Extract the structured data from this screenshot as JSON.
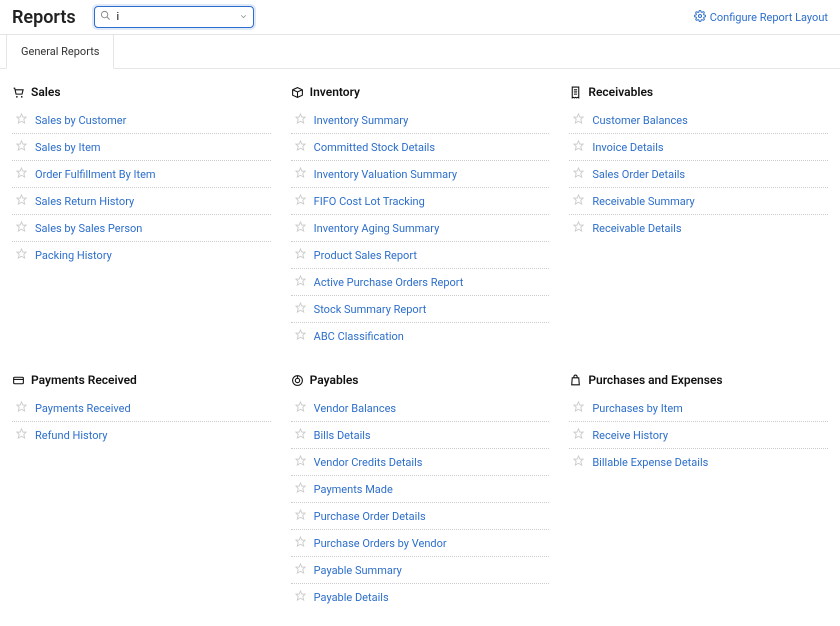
{
  "header": {
    "title": "Reports",
    "search_value": "i",
    "config_label": "Configure Report Layout"
  },
  "tabs": [
    {
      "label": "General Reports"
    }
  ],
  "sections": [
    {
      "title": "Sales",
      "icon": "cart",
      "items": [
        "Sales by Customer",
        "Sales by Item",
        "Order Fulfillment By Item",
        "Sales Return History",
        "Sales by Sales Person",
        "Packing History"
      ]
    },
    {
      "title": "Inventory",
      "icon": "box",
      "items": [
        "Inventory Summary",
        "Committed Stock Details",
        "Inventory Valuation Summary",
        "FIFO Cost Lot Tracking",
        "Inventory Aging Summary",
        "Product Sales Report",
        "Active Purchase Orders Report",
        "Stock Summary Report",
        "ABC Classification"
      ]
    },
    {
      "title": "Receivables",
      "icon": "receipt",
      "items": [
        "Customer Balances",
        "Invoice Details",
        "Sales Order Details",
        "Receivable Summary",
        "Receivable Details"
      ]
    },
    {
      "title": "Payments Received",
      "icon": "card",
      "items": [
        "Payments Received",
        "Refund History"
      ]
    },
    {
      "title": "Payables",
      "icon": "target",
      "items": [
        "Vendor Balances",
        "Bills Details",
        "Vendor Credits Details",
        "Payments Made",
        "Purchase Order Details",
        "Purchase Orders by Vendor",
        "Payable Summary",
        "Payable Details"
      ]
    },
    {
      "title": "Purchases and Expenses",
      "icon": "bag",
      "items": [
        "Purchases by Item",
        "Receive History",
        "Billable Expense Details"
      ]
    }
  ]
}
